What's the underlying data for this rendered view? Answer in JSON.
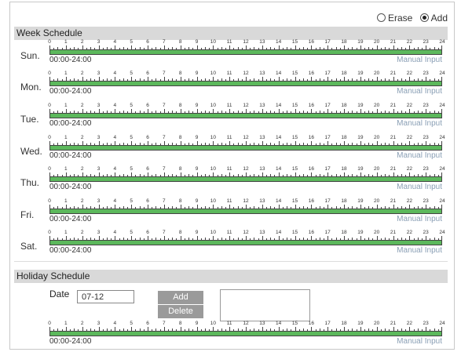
{
  "mode": {
    "erase_label": "Erase",
    "add_label": "Add",
    "selected": "Add"
  },
  "week": {
    "title": "Week Schedule",
    "days": [
      {
        "label": "Sun.",
        "range": "00:00-24:00",
        "manual": "Manual Input"
      },
      {
        "label": "Mon.",
        "range": "00:00-24:00",
        "manual": "Manual Input"
      },
      {
        "label": "Tue.",
        "range": "00:00-24:00",
        "manual": "Manual Input"
      },
      {
        "label": "Wed.",
        "range": "00:00-24:00",
        "manual": "Manual Input"
      },
      {
        "label": "Thu.",
        "range": "00:00-24:00",
        "manual": "Manual Input"
      },
      {
        "label": "Fri.",
        "range": "00:00-24:00",
        "manual": "Manual Input"
      },
      {
        "label": "Sat.",
        "range": "00:00-24:00",
        "manual": "Manual Input"
      }
    ]
  },
  "holiday": {
    "title": "Holiday Schedule",
    "date_label": "Date",
    "date_value": "07-12",
    "add_label": "Add",
    "delete_label": "Delete",
    "range": "00:00-24:00",
    "manual": "Manual Input"
  },
  "hours": [
    "0",
    "1",
    "2",
    "3",
    "4",
    "5",
    "6",
    "7",
    "8",
    "9",
    "10",
    "11",
    "12",
    "13",
    "14",
    "15",
    "16",
    "17",
    "18",
    "19",
    "20",
    "21",
    "22",
    "23",
    "24"
  ],
  "colors": {
    "bar": "#5cb85c",
    "header_bg": "#d9d9d9",
    "button_bg": "#9a9a9a",
    "link": "#8a9fb5"
  }
}
